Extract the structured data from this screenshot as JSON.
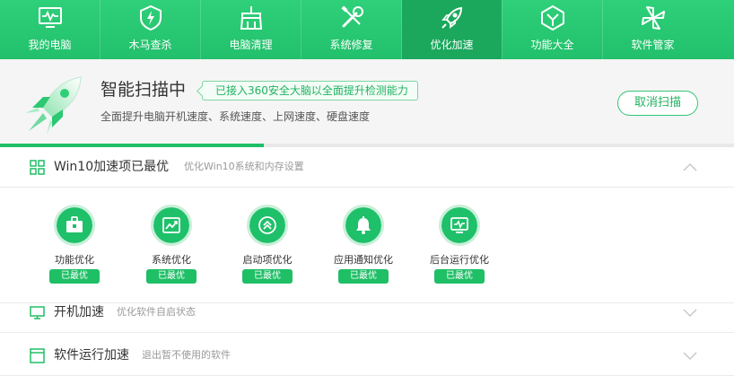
{
  "nav": [
    {
      "label": "我的电脑",
      "icon": "monitor-pulse-icon"
    },
    {
      "label": "木马查杀",
      "icon": "shield-bolt-icon"
    },
    {
      "label": "电脑清理",
      "icon": "broom-icon"
    },
    {
      "label": "系统修复",
      "icon": "wrench-screwdriver-icon"
    },
    {
      "label": "优化加速",
      "icon": "rocket-icon",
      "active": true
    },
    {
      "label": "功能大全",
      "icon": "hexagon-check-icon"
    },
    {
      "label": "软件管家",
      "icon": "windmill-icon"
    }
  ],
  "scan": {
    "title": "智能扫描中",
    "tag": "已接入360安全大脑以全面提升检测能力",
    "subtitle": "全面提升电脑开机速度、系统速度、上网速度、硬盘速度",
    "cancel_label": "取消扫描",
    "progress": 0.36
  },
  "sections": [
    {
      "title": "Win10加速项已最优",
      "desc": "优化Win10系统和内存设置",
      "icon": "grid-icon",
      "expanded": true
    },
    {
      "title": "开机加速",
      "desc": "优化软件自启状态",
      "icon": "monitor-icon",
      "expanded": false
    },
    {
      "title": "软件运行加速",
      "desc": "退出暂不使用的软件",
      "icon": "app-window-icon",
      "expanded": false
    }
  ],
  "items": [
    {
      "name": "功能优化",
      "status": "已最优",
      "icon": "toolbox-icon"
    },
    {
      "name": "系统优化",
      "status": "已最优",
      "icon": "chart-window-icon"
    },
    {
      "name": "启动项优化",
      "status": "已最优",
      "icon": "double-chevron-up-icon"
    },
    {
      "name": "应用通知优化",
      "status": "已最优",
      "icon": "bell-icon"
    },
    {
      "name": "后台运行优化",
      "status": "已最优",
      "icon": "monitor-wave-icon"
    }
  ],
  "colors": {
    "brand": "#22c06c",
    "brand_dark": "#1ba85d",
    "accent_text": "#21b361"
  }
}
